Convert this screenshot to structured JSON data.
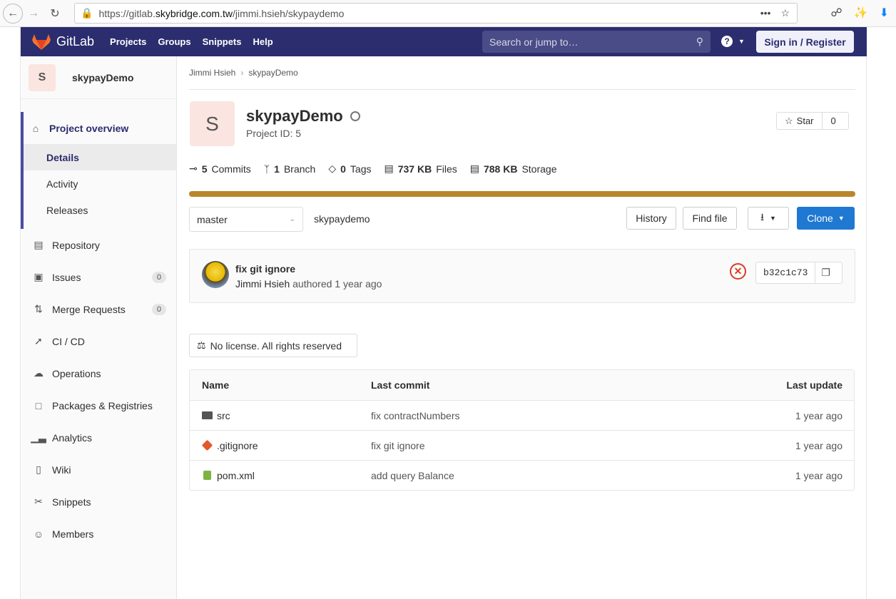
{
  "browser": {
    "url_prefix": "https://gitlab.",
    "url_host": "skybridge.com.tw",
    "url_path": "/jimmi.hsieh/skypaydemo",
    "more_glyph": "•••"
  },
  "header": {
    "logo_text": "GitLab",
    "nav": [
      "Projects",
      "Groups",
      "Snippets",
      "Help"
    ],
    "search_placeholder": "Search or jump to…",
    "help_glyph": "?",
    "signin_label": "Sign in / Register"
  },
  "sidebar": {
    "project_initial": "S",
    "project_name": "skypayDemo",
    "overview": {
      "label": "Project overview",
      "subitems": [
        "Details",
        "Activity",
        "Releases"
      ]
    },
    "items": [
      {
        "label": "Repository",
        "icon": "book-icon"
      },
      {
        "label": "Issues",
        "icon": "issues-icon",
        "badge": "0"
      },
      {
        "label": "Merge Requests",
        "icon": "merge-icon",
        "badge": "0"
      },
      {
        "label": "CI / CD",
        "icon": "rocket-icon"
      },
      {
        "label": "Operations",
        "icon": "cloud-icon"
      },
      {
        "label": "Packages & Registries",
        "icon": "package-icon"
      },
      {
        "label": "Analytics",
        "icon": "chart-icon"
      },
      {
        "label": "Wiki",
        "icon": "wiki-icon"
      },
      {
        "label": "Snippets",
        "icon": "scissors-icon"
      },
      {
        "label": "Members",
        "icon": "members-icon"
      }
    ]
  },
  "breadcrumb": {
    "owner": "Jimmi Hsieh",
    "project": "skypayDemo"
  },
  "project": {
    "initial": "S",
    "title": "skypayDemo",
    "id_label": "Project ID: 5",
    "star_label": "Star",
    "star_count": "0"
  },
  "stats": {
    "commits_count": "5",
    "commits_label": "Commits",
    "branch_count": "1",
    "branch_label": "Branch",
    "tags_count": "0",
    "tags_label": "Tags",
    "files_size": "737 KB",
    "files_label": "Files",
    "storage_size": "788 KB",
    "storage_label": "Storage"
  },
  "language_bar_color": "#b8862b",
  "controls": {
    "branch": "master",
    "path": "skypaydemo",
    "history_label": "History",
    "find_file_label": "Find file",
    "clone_label": "Clone"
  },
  "last_commit": {
    "title": "fix git ignore",
    "author": "Jimmi Hsieh",
    "meta": "authored 1 year ago",
    "pipeline_status": "failed",
    "sha": "b32c1c73"
  },
  "license_label": "No license. All rights reserved",
  "tree": {
    "headers": {
      "name": "Name",
      "commit": "Last commit",
      "update": "Last update"
    },
    "rows": [
      {
        "name": "src",
        "commit": "fix contractNumbers",
        "update": "1 year ago",
        "icon": "folder-icon"
      },
      {
        "name": ".gitignore",
        "commit": "fix git ignore",
        "update": "1 year ago",
        "icon": "git-file-icon"
      },
      {
        "name": "pom.xml",
        "commit": "add query Balance",
        "update": "1 year ago",
        "icon": "xml-file-icon"
      }
    ]
  }
}
